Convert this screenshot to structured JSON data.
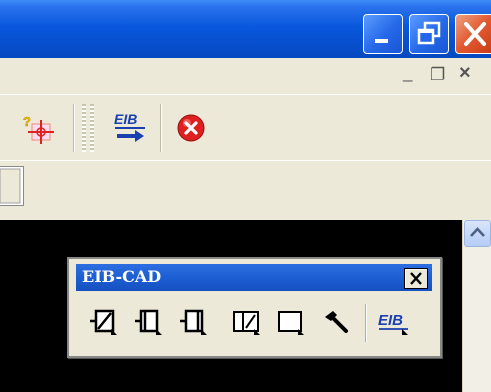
{
  "window": {
    "caption_buttons": [
      "minimize",
      "maximize",
      "close"
    ]
  },
  "mdi_controls": {
    "minimize_glyph": "_",
    "restore_glyph": "❐",
    "close_glyph": "×"
  },
  "toolbar": {
    "buttons": [
      "query-object-icon",
      "eib-export-icon",
      "stop-icon"
    ]
  },
  "floating_toolbar": {
    "title": "EIB-CAD",
    "close_glyph": "✕",
    "tools": [
      "draw-slanted-box-icon",
      "draw-left-bracket-box-icon",
      "draw-right-bracket-box-icon",
      "draw-split-box-icon",
      "draw-corner-box-icon",
      "hammer-icon",
      "eib-logo-icon"
    ],
    "logo_text": "EIB"
  },
  "scrollbar": {
    "up_arrow": "chevron-up-icon"
  },
  "colors": {
    "titlebar": "#0958dd",
    "close_button": "#e1582f",
    "canvas": "#000000",
    "face": "#ece9d8"
  }
}
